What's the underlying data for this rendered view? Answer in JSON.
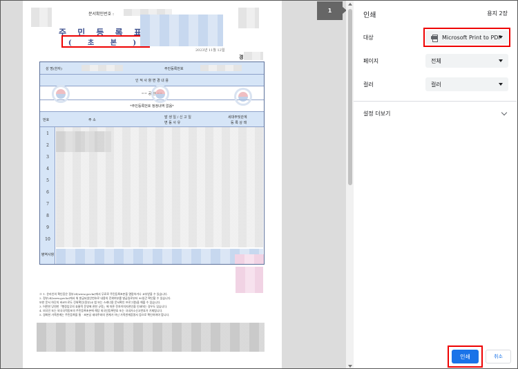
{
  "preview": {
    "page_indicator": "1",
    "document": {
      "confirm_number_label": "문서확인번호 :",
      "title": "주 민 등 록 표",
      "subtitle": "( 초   본 )",
      "date": "2023년 11월 12일",
      "region": "경기도",
      "name_label": "성 명(한자)",
      "resident_number_label": "주민등록번호",
      "personal_changes_header": "인 적 사 항 변 경 내 용",
      "blank_line": "==     공     란     ==",
      "no_change_note": "*주민등록번호 정정내역 없음*",
      "columns": {
        "number": "번호",
        "address": "주                    소",
        "date_of_change": "발 생 일 / 신 고 일",
        "change_reason": "변      동      사      유",
        "household_relation": "세대주및관계",
        "registration_status": "등 록 상 태"
      },
      "row_numbers": [
        "1",
        "2",
        "3",
        "4",
        "5",
        "6",
        "7",
        "8",
        "9",
        "10"
      ],
      "military_label": "병역사항",
      "notes": [
        "※  1. 온라인의 확인증은 정부24(www.gov.kr)에서 무료로 주민등록초본을 열람하거나 교부받을 수 있습니다.",
        "2. 정부24(www.gov.kr)에서 위 발급되었인번호로 내용의 진위여부를 발급일로부터 90일간 확인할 수 있습니다.",
        "또한 문서 하단의 바코드로도 진위확인(정부24 앱 또는 스캐너용 문서확인 프로그램)을 해볼 수 있습니다.",
        "3. 어떤한 당연한「행정입무의 효율적 운영에 관한 규정」에 따른 전자이미지관인을 인쇄하는 경우도 있습니다.",
        "4. 외국인 또는 외국국적동포의 주민등록초본에 해당 외국인등록번호 또는 국내거소신고번호가 기재됩니다.",
        "5. 경화한 가족관계는 주민등록을 통 · 초본상 세대주와의 관계가 아닌 가족관계증명서 등으로 확인하여야 합니다."
      ]
    }
  },
  "panel": {
    "title": "인쇄",
    "sheet_count": "용지 2장",
    "destination_label": "대상",
    "destination_value": "Microsoft Print to PDF",
    "pages_label": "페이지",
    "pages_value": "전체",
    "color_label": "컬러",
    "color_value": "컬러",
    "more_settings": "설정 더보기",
    "print_button": "인쇄",
    "cancel_button": "취소"
  },
  "colors": {
    "accent": "#1a73e8",
    "highlight": "#e00000",
    "table_band": "#d6e5f7"
  }
}
